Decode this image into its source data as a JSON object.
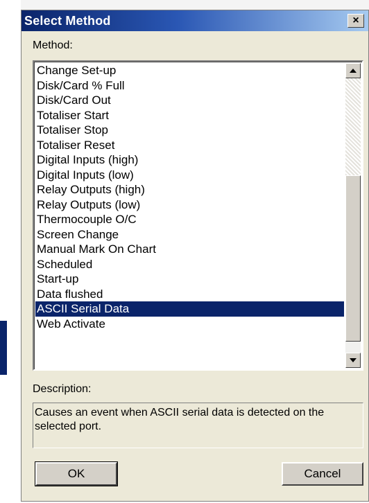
{
  "dialog": {
    "title": "Select Method",
    "close_glyph": "×",
    "method_label": "Method:",
    "description_label": "Description:",
    "description_text": "Causes an event when ASCII serial data is detected on the selected port.",
    "ok_label": "OK",
    "cancel_label": "Cancel"
  },
  "method_list": {
    "items": [
      "Change Set-up",
      "Disk/Card % Full",
      "Disk/Card Out",
      "Totaliser Start",
      "Totaliser Stop",
      "Totaliser Reset",
      "Digital Inputs (high)",
      "Digital Inputs (low)",
      "Relay Outputs (high)",
      "Relay Outputs (low)",
      "Thermocouple O/C",
      "Screen Change",
      "Manual Mark On Chart",
      "Scheduled",
      "Start-up",
      "Data flushed",
      "ASCII Serial Data",
      "Web Activate"
    ],
    "selected_index": 16
  },
  "colors": {
    "titlebar_start": "#0a246a",
    "titlebar_end": "#a6caf0",
    "selection": "#0a246a",
    "dialog_bg": "#ece9d8"
  },
  "icons": {
    "close": "close-icon",
    "scroll_up": "scroll-up-arrow-icon",
    "scroll_down": "scroll-down-arrow-icon"
  }
}
